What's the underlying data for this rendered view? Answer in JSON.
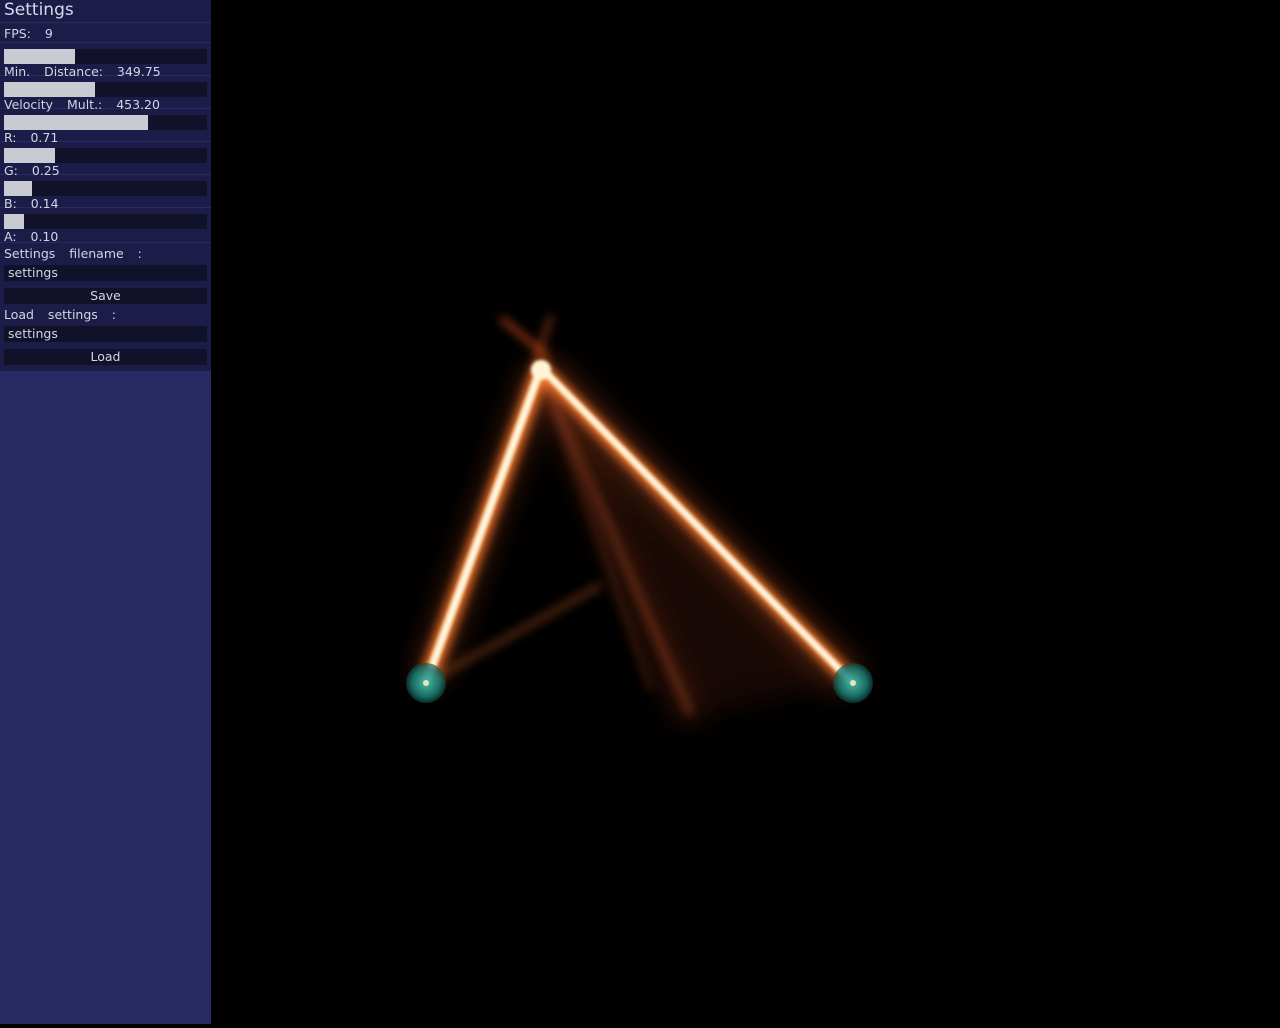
{
  "panel": {
    "title": "Settings",
    "fps_label": "FPS:  9",
    "sliders": [
      {
        "label": "Min.  Distance:  349.75",
        "fraction": 0.35
      },
      {
        "label": "Velocity  Mult.:  453.20",
        "fraction": 0.45
      },
      {
        "label": "R:  0.71",
        "fraction": 0.71
      },
      {
        "label": "G:  0.25",
        "fraction": 0.25
      },
      {
        "label": "B:  0.14",
        "fraction": 0.14
      },
      {
        "label": "A:  0.10",
        "fraction": 0.1
      }
    ],
    "save_section": {
      "label": "Settings  filename  :",
      "value": "settings",
      "button": "Save"
    },
    "load_section": {
      "label": "Load  settings  :",
      "value": "settings",
      "button": "Load"
    }
  },
  "scene": {
    "beam_color": "#ff7a3a",
    "core_color": "#fff6d8",
    "node_color": "#1a8a80"
  }
}
